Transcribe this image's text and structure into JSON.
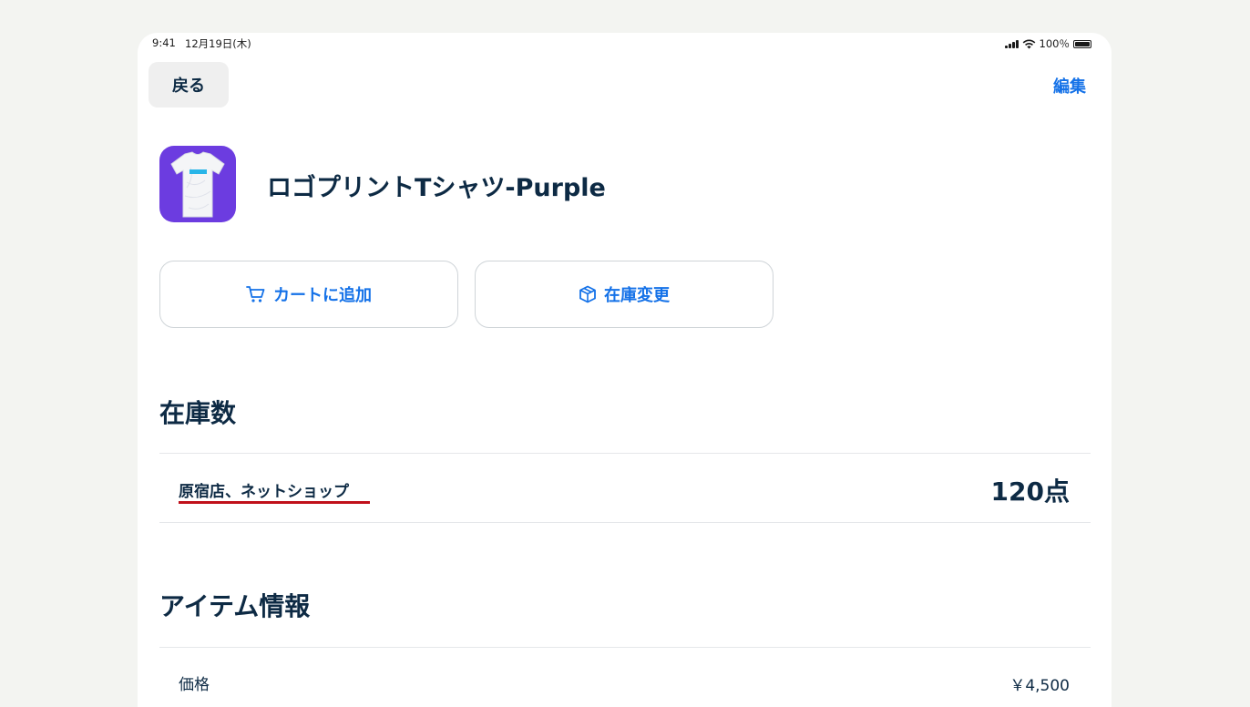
{
  "status_bar": {
    "time": "9:41",
    "date": "12月19日(木)",
    "battery": "100％"
  },
  "nav": {
    "back_label": "戻る",
    "edit_label": "編集"
  },
  "product": {
    "title": "ロゴプリントTシャツ-Purple",
    "icon": "tshirt-icon"
  },
  "actions": {
    "cart_label": "カートに追加",
    "cart_icon": "cart-icon",
    "stock_label": "在庫変更",
    "stock_icon": "box-icon"
  },
  "stock_section": {
    "title": "在庫数",
    "location": "原宿店、ネットショップ",
    "count": "120点"
  },
  "info_section": {
    "title": "アイテム情報",
    "price_label": "価格",
    "price_value": "￥4,500"
  },
  "colors": {
    "accent": "#1572e8",
    "text": "#0d2a44",
    "icon_bg": "#6c3ce0",
    "underline": "#c0101a"
  }
}
